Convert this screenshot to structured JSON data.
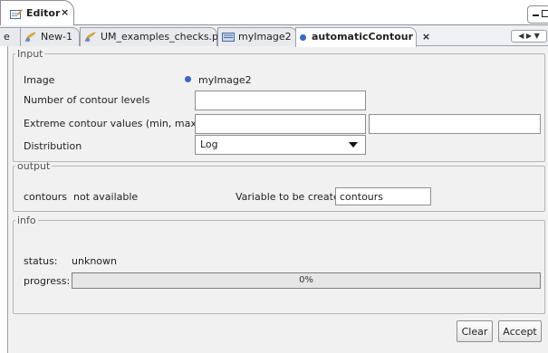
{
  "view": {
    "title": "Editor",
    "close": "×"
  },
  "tabs": [
    {
      "label": "e"
    },
    {
      "label": "New-1"
    },
    {
      "label": "UM_examples_checks.py"
    },
    {
      "label": "myImage2"
    },
    {
      "label": "automaticContour",
      "close": "×",
      "active": true
    }
  ],
  "input": {
    "legend": "Input",
    "image_label": "Image",
    "image_value": "myImage2",
    "levels_label": "Number of contour levels",
    "levels_value": "",
    "extremes_label": "Extreme contour values (min, max)",
    "min_value": "",
    "max_value": "",
    "distribution_label": "Distribution",
    "distribution_value": "Log"
  },
  "output": {
    "legend": "output",
    "status_text": "contours  not available",
    "variable_label": "Variable to be created",
    "variable_value": "contours"
  },
  "info": {
    "legend": "info",
    "status_label": "status:",
    "status_value": "unknown",
    "progress_label": "progress:",
    "progress_text": "0%",
    "progress_value": 0
  },
  "buttons": {
    "clear": "Clear",
    "accept": "Accept"
  },
  "colors": {
    "accent_dot": "#3a66c8",
    "panel_bg": "#f1f1f1"
  }
}
